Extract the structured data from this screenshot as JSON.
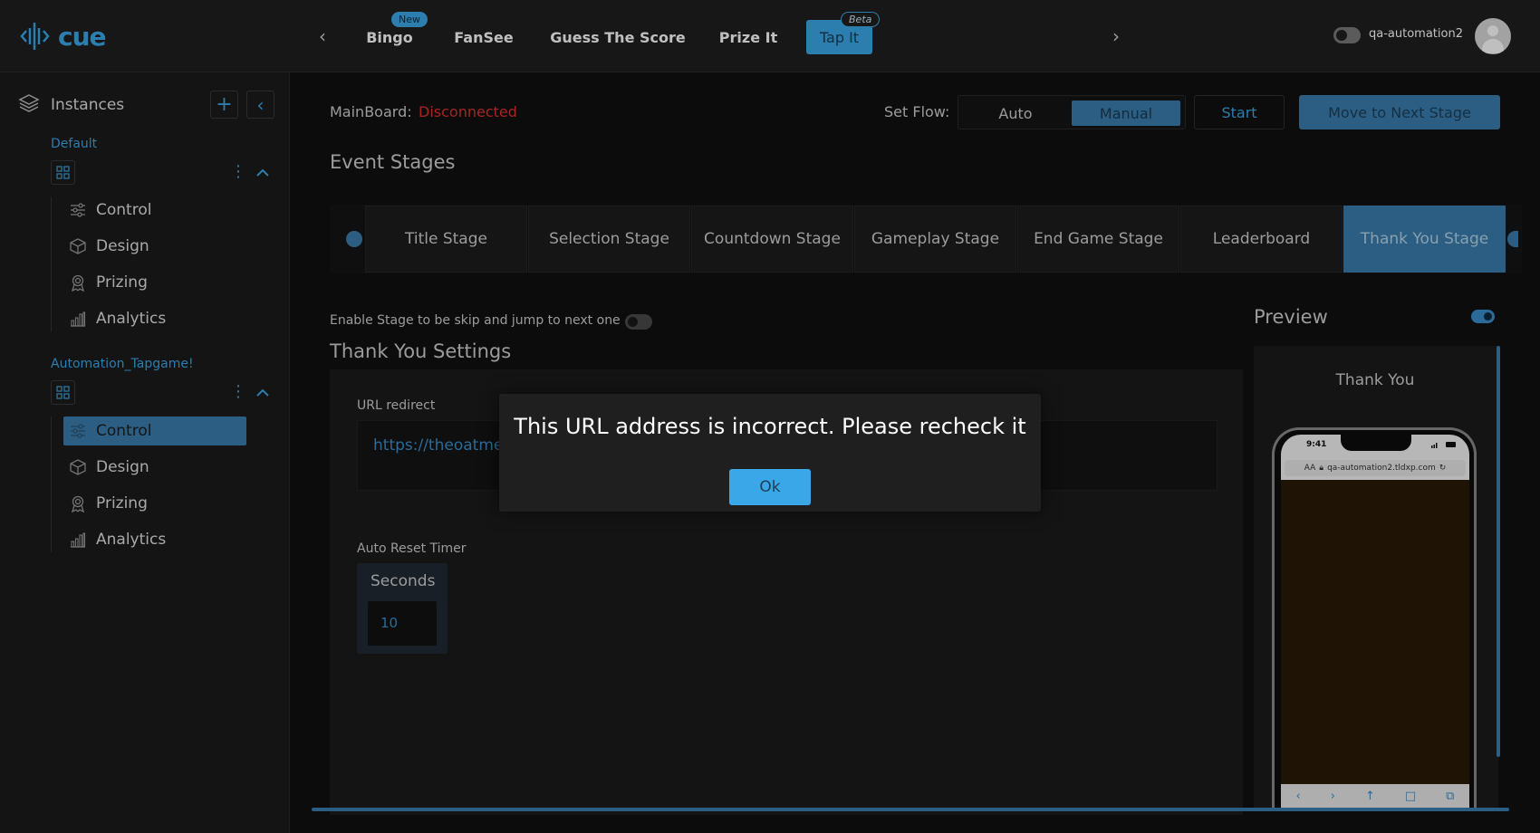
{
  "header": {
    "logo_text": "cue",
    "tabs": [
      {
        "label": "Bingo",
        "badge": "New"
      },
      {
        "label": "FanSee",
        "badge": ""
      },
      {
        "label": "Guess The Score",
        "badge": ""
      },
      {
        "label": "Prize It",
        "badge": ""
      },
      {
        "label": "Tap It",
        "badge": "Beta"
      }
    ],
    "active_tab": "Tap It",
    "username": "qa-automation2"
  },
  "sidebar": {
    "title": "Instances",
    "groups": [
      {
        "name": "Default",
        "items": [
          {
            "label": "Control",
            "icon": "sliders-icon"
          },
          {
            "label": "Design",
            "icon": "cube-icon"
          },
          {
            "label": "Prizing",
            "icon": "award-icon"
          },
          {
            "label": "Analytics",
            "icon": "bar-chart-icon"
          }
        ]
      },
      {
        "name": "Automation_Tapgame!",
        "active_item": "Control",
        "items": [
          {
            "label": "Control",
            "icon": "sliders-icon"
          },
          {
            "label": "Design",
            "icon": "cube-icon"
          },
          {
            "label": "Prizing",
            "icon": "award-icon"
          },
          {
            "label": "Analytics",
            "icon": "bar-chart-icon"
          }
        ]
      }
    ]
  },
  "main": {
    "mainboard_label": "MainBoard:",
    "mainboard_status": "Disconnected",
    "set_flow_label": "Set Flow:",
    "flow_options": [
      "Auto",
      "Manual"
    ],
    "flow_selected": "Manual",
    "start_label": "Start",
    "next_stage_label": "Move to Next Stage",
    "event_stages_heading": "Event Stages",
    "stages": [
      "Title Stage",
      "Selection Stage",
      "Countdown Stage",
      "Gameplay Stage",
      "End Game Stage",
      "Leaderboard",
      "Thank You Stage"
    ],
    "active_stage": "Thank You Stage",
    "skip_label": "Enable Stage to be skip and jump to next one",
    "settings_heading": "Thank You Settings",
    "url_redirect_label": "URL redirect",
    "url_value": "https://theoatme",
    "auto_reset_label": "Auto Reset Timer",
    "seconds_label": "Seconds",
    "seconds_value": "10"
  },
  "preview": {
    "title": "Preview",
    "heading": "Thank You",
    "phone_time": "9:41",
    "phone_url": "qa-automation2.tldxp.com",
    "phone_aa": "AA"
  },
  "dialog": {
    "message": "This URL address is incorrect. Please recheck it",
    "ok_label": "Ok"
  },
  "colors": {
    "accent": "#3aa8e8",
    "accent_dark": "#3a7eae",
    "error": "#e0322e"
  }
}
